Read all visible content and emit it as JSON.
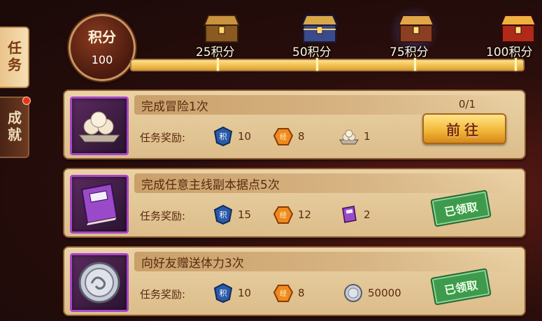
{
  "side_tabs": [
    {
      "label": "任务",
      "active": true
    },
    {
      "label": "成就",
      "active": false,
      "has_notification": true
    }
  ],
  "points": {
    "title": "积分",
    "value": "100"
  },
  "progress": {
    "current": 100,
    "max": 100,
    "milestones": [
      {
        "label": "25积分",
        "value": 25
      },
      {
        "label": "50积分",
        "value": 50
      },
      {
        "label": "75积分",
        "value": 75
      },
      {
        "label": "100积分",
        "value": 100
      }
    ]
  },
  "tasks": [
    {
      "title": "完成冒险1次",
      "progress": "0/1",
      "reward_label": "任务奖励:",
      "icon": "steamed-buns-icon",
      "rewards": [
        {
          "icon": "points-shield-icon",
          "value": "10"
        },
        {
          "icon": "exp-gem-icon",
          "value": "8"
        },
        {
          "icon": "steamed-buns-icon",
          "value": "1"
        }
      ],
      "action": "前往",
      "status": "go"
    },
    {
      "title": "完成任意主线副本据点5次",
      "progress": "",
      "reward_label": "任务奖励:",
      "icon": "purple-book-icon",
      "rewards": [
        {
          "icon": "points-shield-icon",
          "value": "15"
        },
        {
          "icon": "exp-gem-icon",
          "value": "12"
        },
        {
          "icon": "purple-book-icon",
          "value": "2"
        }
      ],
      "action": "已领取",
      "status": "claimed"
    },
    {
      "title": "向好友赠送体力3次",
      "progress": "",
      "reward_label": "任务奖励:",
      "icon": "silver-coin-icon",
      "rewards": [
        {
          "icon": "points-shield-icon",
          "value": "10"
        },
        {
          "icon": "exp-gem-icon",
          "value": "8"
        },
        {
          "icon": "silver-coin-icon",
          "value": "50000"
        }
      ],
      "action": "已领取",
      "status": "claimed"
    }
  ],
  "colors": {
    "card_bg": "#e4c896",
    "title_text": "#5a2a10",
    "claimed_green": "#3e9a4c",
    "go_button": "#f2b93a"
  }
}
